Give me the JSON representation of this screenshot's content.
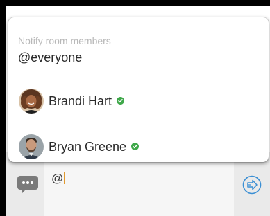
{
  "mention_popup": {
    "header": "Notify room members",
    "everyone": "@everyone",
    "members": [
      {
        "name": "Brandi Hart",
        "status": "online",
        "avatar_icon": "user-avatar"
      },
      {
        "name": "Bryan Greene",
        "status": "online",
        "avatar_icon": "user-avatar"
      }
    ]
  },
  "composer": {
    "input_value": "@",
    "left_icon": "chat-bubble-icon",
    "send_icon": "send-arrow-icon"
  },
  "colors": {
    "online": "#3fa84a",
    "send_accent": "#3b8fd4",
    "caret": "#e09a30",
    "chat_icon": "#7a7a7a"
  }
}
